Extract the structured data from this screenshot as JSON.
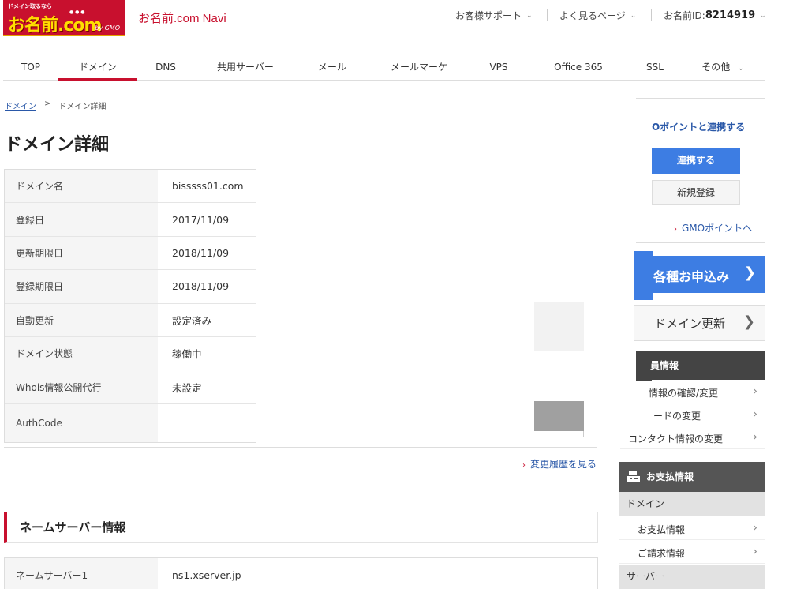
{
  "header": {
    "logo_tagline": "ドメイン取るなら",
    "logo_main": "お名前.com",
    "logo_sub": "by GMO",
    "app_title": "お名前.com Navi",
    "support_label": "お客様サポート",
    "frequent_pages_label": "よく見るページ",
    "member_id_label": "お名前ID:",
    "member_id_value": "8214919"
  },
  "nav": {
    "items": [
      "TOP",
      "ドメイン",
      "DNS",
      "共用サーバー",
      "メール",
      "メールマーケ",
      "VPS",
      "Office 365",
      "SSL",
      "その他"
    ],
    "active": "ドメイン"
  },
  "breadcrumb": {
    "root": "ドメイン",
    "separator": ">",
    "current": "ドメイン詳細"
  },
  "page_title": "ドメイン詳細",
  "domain_detail": {
    "rows": [
      {
        "label": "ドメイン名",
        "value": "bisssss01.com"
      },
      {
        "label": "登録日",
        "value": "2017/11/09"
      },
      {
        "label": "更新期限日",
        "value": "2018/11/09"
      },
      {
        "label": "登録期限日",
        "value": "2018/11/09"
      },
      {
        "label": "自動更新",
        "value": "設定済み"
      },
      {
        "label": "ドメイン状態",
        "value": "稼働中"
      },
      {
        "label": "Whois情報公開代行",
        "value": "未設定"
      },
      {
        "label": "AuthCode",
        "value": ""
      }
    ],
    "history_link": "変更履歴を見る"
  },
  "nameserver": {
    "section_title": "ネームサーバー情報",
    "rows": [
      {
        "label": "ネームサーバー1",
        "value": "ns1.xserver.jp"
      }
    ]
  },
  "sidebar": {
    "gmo_title": "Oポイントと連携する",
    "gmo_link_button": "連携する",
    "gmo_register_button": "新規登録",
    "gmo_points_link": "GMOポイントへ",
    "apply_button": "各種お申込み",
    "renew_button": "ドメイン更新",
    "member_section": {
      "title": "員情報",
      "items": [
        "情報の確認/変更",
        "ードの変更",
        "コンタクト情報の変更"
      ]
    },
    "payment_section": {
      "title": "お支払情報",
      "domain_group": "ドメイン",
      "domain_items": [
        "お支払情報",
        "ご請求情報"
      ],
      "server_group": "サーバー"
    }
  },
  "colors": {
    "brand_red": "#c8102e",
    "accent_blue": "#3d7de3",
    "link_blue": "#2a58a8"
  }
}
